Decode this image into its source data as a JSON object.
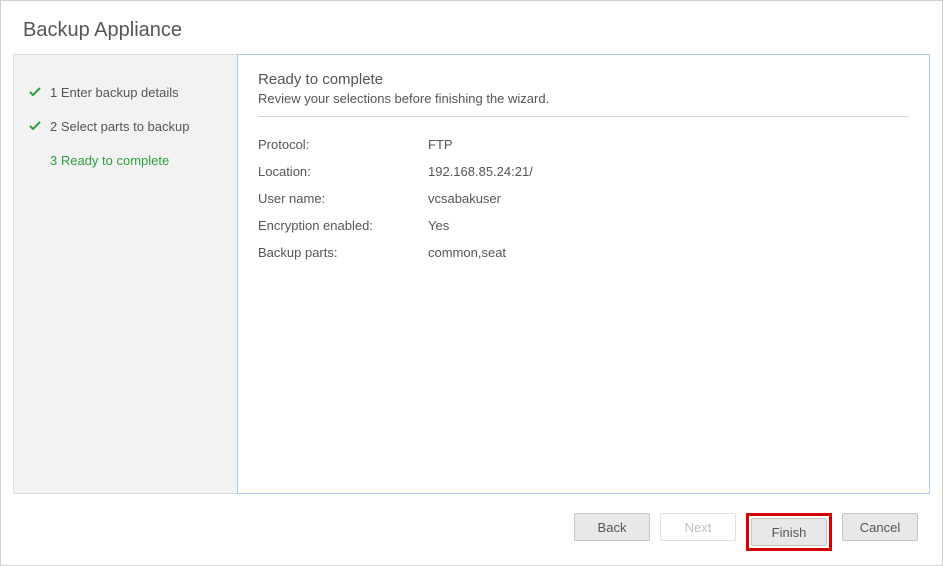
{
  "title": "Backup Appliance",
  "sidebar": {
    "steps": [
      {
        "label": "1 Enter backup details",
        "done": true,
        "active": false
      },
      {
        "label": "2 Select parts to backup",
        "done": true,
        "active": false
      },
      {
        "label": "3 Ready to complete",
        "done": false,
        "active": true
      }
    ]
  },
  "main": {
    "heading": "Ready to complete",
    "subheading": "Review your selections before finishing the wizard.",
    "rows": [
      {
        "label": "Protocol:",
        "value": "FTP"
      },
      {
        "label": "Location:",
        "value": "192.168.85.24:21/"
      },
      {
        "label": "User name:",
        "value": "vcsabakuser"
      },
      {
        "label": "Encryption enabled:",
        "value": "Yes"
      },
      {
        "label": "Backup parts:",
        "value": "common,seat"
      }
    ]
  },
  "footer": {
    "back": "Back",
    "next": "Next",
    "finish": "Finish",
    "cancel": "Cancel"
  }
}
